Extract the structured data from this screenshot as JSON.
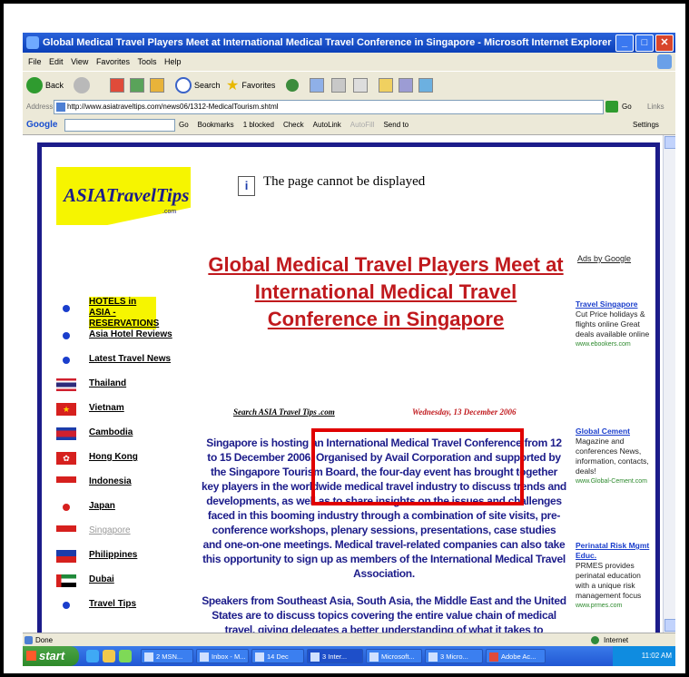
{
  "browser": {
    "title": "Global Medical Travel Players Meet at International Medical Travel Conference in Singapore - Microsoft Internet Explorer",
    "menu": [
      "File",
      "Edit",
      "View",
      "Favorites",
      "Tools",
      "Help"
    ],
    "toolbar": {
      "back": "Back",
      "search": "Search",
      "favorites": "Favorites"
    },
    "address_label": "Address",
    "url": "http://www.asiatraveltips.com/news06/1312-MedicalTourism.shtml",
    "go_label": "Go",
    "links_label": "Links",
    "google": {
      "logo": "Google",
      "items": [
        "Go",
        "Bookmarks",
        "1 blocked",
        "Check",
        "AutoLink",
        "AutoFill",
        "Send to"
      ],
      "settings": "Settings"
    },
    "status": {
      "left": "Done",
      "zone": "Internet"
    }
  },
  "page": {
    "logo_text": "ASIATravelTips",
    "logo_com": ".com",
    "error_text": "The page cannot be displayed",
    "headline": "Global Medical Travel Players Meet at International Medical Travel Conference in Singapore",
    "ads_by": "Ads by Google",
    "nav": [
      {
        "label": "HOTELS in ASIA - RESERVATIONS",
        "highlight": true,
        "icon": "bullet-icon",
        "color": "#1a3ecc"
      },
      {
        "label": "Asia Hotel Reviews",
        "icon": "bullet-icon",
        "color": "#1a3ecc"
      },
      {
        "label": "Latest Travel News",
        "icon": "bullet-icon",
        "color": "#1a3ecc"
      },
      {
        "label": "Thailand",
        "icon": "thailand-flag-icon"
      },
      {
        "label": "Vietnam",
        "icon": "vietnam-flag-icon"
      },
      {
        "label": "Cambodia",
        "icon": "cambodia-flag-icon"
      },
      {
        "label": "Hong Kong",
        "icon": "hongkong-flag-icon"
      },
      {
        "label": "Indonesia",
        "icon": "indonesia-flag-icon"
      },
      {
        "label": "Japan",
        "icon": "japan-flag-icon"
      },
      {
        "label": "Singapore",
        "icon": "singapore-flag-icon",
        "muted": true
      },
      {
        "label": "Philippines",
        "icon": "philippines-flag-icon"
      },
      {
        "label": "Dubai",
        "icon": "uae-flag-icon"
      },
      {
        "label": "Travel Tips",
        "icon": "bullet-icon",
        "color": "#1a3ecc"
      }
    ],
    "search_link": "Search ASIA Travel Tips .com",
    "date": "Wednesday, 13 December 2006",
    "paragraph1": "Singapore is hosting an International Medical Travel Conference from 12 to 15 December 2006. Organised by Avail Corporation and supported by the Singapore Tourism Board, the four-day event has brought together key players in the worldwide medical travel industry to discuss trends and developments, as well as to share insights on the issues and challenges faced in this booming industry through a combination of site visits, pre-conference workshops, plenary sessions, presentations, case studies and one-on-one meetings. Medical travel-related companies can also take this opportunity to sign up as members of the International Medical Travel Association.",
    "paragraph2": "Speakers from Southeast Asia, South Asia, the Middle East and the United States are to discuss topics covering the entire value chain of medical travel, giving delegates a better understanding of what it takes to internationalise medical services, the national and international issues involved, the roles of",
    "ads": [
      {
        "title": "Travel Singapore",
        "body": "Cut Price holidays & flights online Great deals available online",
        "url": "www.ebookers.com"
      },
      {
        "title": "Global Cement",
        "body": "Magazine and conferences News, information, contacts, deals!",
        "url": "www.Global-Cement.com"
      },
      {
        "title": "Perinatal Risk Mgmt Educ.",
        "body": "PRMES provides perinatal education with a unique risk management focus",
        "url": "www.prmes.com"
      }
    ]
  },
  "taskbar": {
    "start": "start",
    "tasks": [
      "2 MSN...",
      "Inbox - M...",
      "14 Dec",
      "3 Inter...",
      "Microsoft...",
      "3 Micro...",
      "Adobe Ac..."
    ],
    "clock": "11:02 AM"
  }
}
